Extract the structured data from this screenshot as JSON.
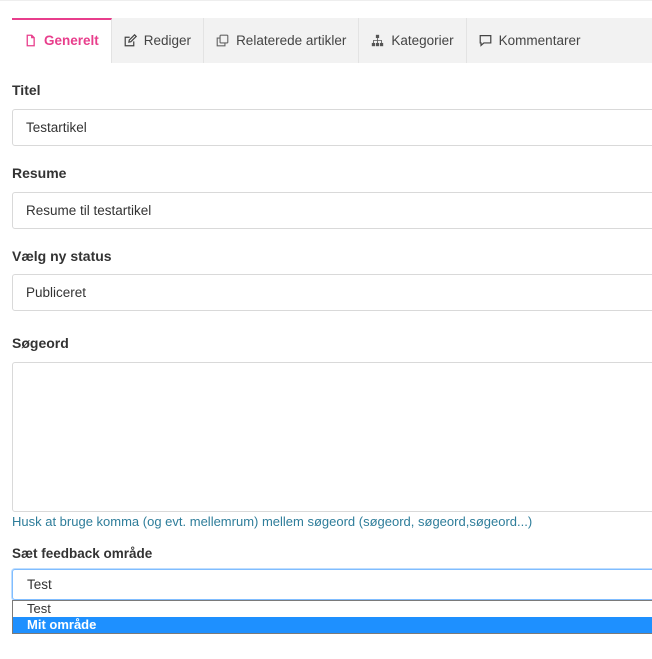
{
  "tabs": [
    {
      "label": "Generelt",
      "icon": "file-icon",
      "active": true
    },
    {
      "label": "Rediger",
      "icon": "edit-icon",
      "active": false
    },
    {
      "label": "Relaterede artikler",
      "icon": "copy-icon",
      "active": false
    },
    {
      "label": "Kategorier",
      "icon": "sitemap-icon",
      "active": false
    },
    {
      "label": "Kommentarer",
      "icon": "comment-icon",
      "active": false
    }
  ],
  "form": {
    "title": {
      "label": "Titel",
      "value": "Testartikel"
    },
    "summary": {
      "label": "Resume",
      "value": "Resume til testartikel"
    },
    "status": {
      "label": "Vælg ny status",
      "value": "Publiceret"
    },
    "keywords": {
      "label": "Søgeord",
      "value": "",
      "hint": "Husk at bruge komma (og evt. mellemrum) mellem søgeord (søgeord, søgeord,søgeord...)"
    },
    "feedback_area": {
      "label": "Sæt feedback område",
      "value": "Test",
      "options": [
        "Test",
        "Mit område"
      ],
      "highlighted_option": "Mit område"
    }
  },
  "colors": {
    "accent": "#e83e8c",
    "hint": "#2e7d9a",
    "dropdown_highlight": "#1e90ff",
    "focus_border": "#80bdff"
  }
}
